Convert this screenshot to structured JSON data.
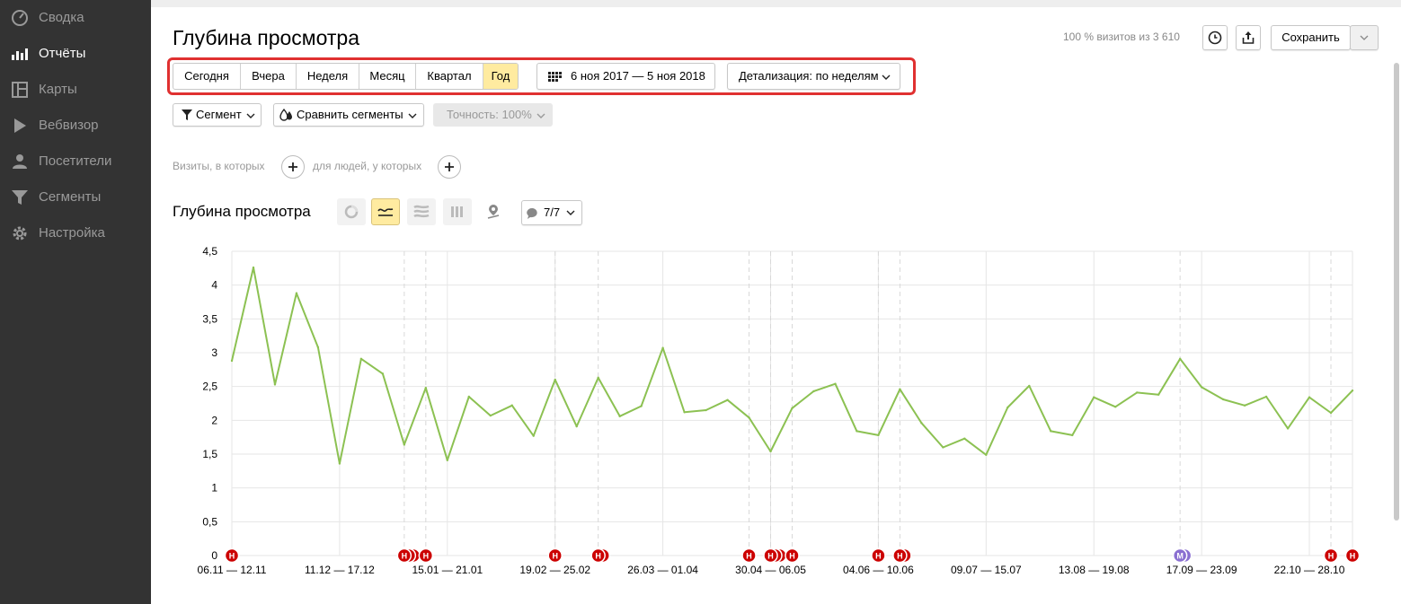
{
  "sidebar": {
    "items": [
      {
        "label": "Сводка",
        "icon": "dashboard-icon",
        "active": false
      },
      {
        "label": "Отчёты",
        "icon": "bar-chart-icon",
        "active": true
      },
      {
        "label": "Карты",
        "icon": "map-layout-icon",
        "active": false
      },
      {
        "label": "Вебвизор",
        "icon": "play-icon",
        "active": false
      },
      {
        "label": "Посетители",
        "icon": "person-icon",
        "active": false
      },
      {
        "label": "Сегменты",
        "icon": "funnel-icon",
        "active": false
      },
      {
        "label": "Настройка",
        "icon": "gear-icon",
        "active": false
      }
    ]
  },
  "header": {
    "title": "Глубина просмотра",
    "visits_info": "100 % визитов из 3 610",
    "save_label": "Сохранить"
  },
  "period": {
    "buttons": [
      "Сегодня",
      "Вчера",
      "Неделя",
      "Месяц",
      "Квартал",
      "Год"
    ],
    "selected": "Год",
    "date_range": "6 ноя 2017 — 5 ноя 2018",
    "detail": "Детализация: по неделям"
  },
  "filters": {
    "segment": "Сегмент",
    "compare": "Сравнить сегменты",
    "accuracy": "Точность: 100%"
  },
  "conditions": {
    "visits_label": "Визиты, в которых",
    "people_label": "для людей, у которых"
  },
  "chart_header": {
    "title": "Глубина просмотра",
    "comments": "7/7"
  },
  "colors": {
    "line": "#8cc152",
    "highlight_box": "#e03030",
    "active_button": "#ffeba0",
    "marker_red": "#cc0000",
    "marker_purple": "#8a6fd1"
  },
  "chart_data": {
    "type": "line",
    "title": "",
    "xlabel": "",
    "ylabel": "",
    "ylim": [
      0,
      4.5
    ],
    "yticks": [
      "0",
      "0,5",
      "1",
      "1,5",
      "2",
      "2,5",
      "3",
      "3,5",
      "4",
      "4,5"
    ],
    "x_tick_labels": [
      "06.11 — 12.11",
      "11.12 — 17.12",
      "15.01 — 21.01",
      "19.02 — 25.02",
      "26.03 — 01.04",
      "30.04 — 06.05",
      "04.06 — 10.06",
      "09.07 — 15.07",
      "13.08 — 19.08",
      "17.09 — 23.09",
      "22.10 — 28.10"
    ],
    "series": [
      {
        "values": [
          2.88,
          4.26,
          2.53,
          3.88,
          3.08,
          1.36,
          2.91,
          2.69,
          1.64,
          2.48,
          1.41,
          2.35,
          2.07,
          2.22,
          1.77,
          2.6,
          1.91,
          2.63,
          2.06,
          2.21,
          3.07,
          2.12,
          2.15,
          2.3,
          2.04,
          1.54,
          2.18,
          2.43,
          2.54,
          1.84,
          1.78,
          2.46,
          1.96,
          1.6,
          1.73,
          1.49,
          2.19,
          2.51,
          1.84,
          1.78,
          2.34,
          2.2,
          2.41,
          2.38,
          2.91,
          2.49,
          2.31,
          2.22,
          2.35,
          1.88,
          2.34,
          2.11,
          2.44
        ]
      }
    ],
    "annotations": [
      {
        "week": 0,
        "type": "Н",
        "count": 1
      },
      {
        "week": 8,
        "type": "Н",
        "count": 3
      },
      {
        "week": 9,
        "type": "Н",
        "count": 1
      },
      {
        "week": 15,
        "type": "Н",
        "count": 1
      },
      {
        "week": 17,
        "type": "Н",
        "count": 2
      },
      {
        "week": 24,
        "type": "Н",
        "count": 1
      },
      {
        "week": 25,
        "type": "Н",
        "count": 3
      },
      {
        "week": 26,
        "type": "Н",
        "count": 1
      },
      {
        "week": 30,
        "type": "Н",
        "count": 1
      },
      {
        "week": 31,
        "type": "Н",
        "count": 2
      },
      {
        "week": 44,
        "type": "М",
        "count": 2
      },
      {
        "week": 51,
        "type": "Н",
        "count": 1
      },
      {
        "week": 52,
        "type": "Н",
        "count": 1
      }
    ]
  }
}
